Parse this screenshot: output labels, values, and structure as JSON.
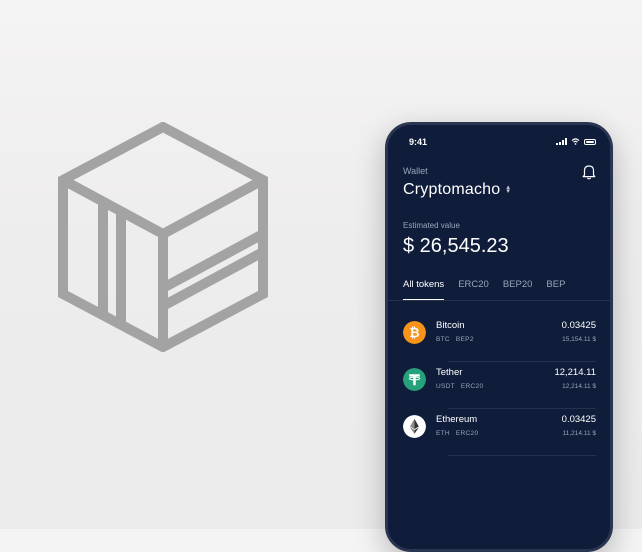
{
  "status": {
    "time": "9:41"
  },
  "wallet": {
    "label": "Wallet",
    "name": "Cryptomacho",
    "name_chevron": "⌃⌄",
    "estimated_label": "Estimated value",
    "estimated_value": "$ 26,545.23"
  },
  "tabs": [
    {
      "label": "All tokens",
      "active": true
    },
    {
      "label": "ERC20",
      "active": false
    },
    {
      "label": "BEP20",
      "active": false
    },
    {
      "label": "BEP",
      "active": false
    }
  ],
  "tokens": [
    {
      "name": "Bitcoin",
      "symbol": "BTC",
      "network": "BEP2",
      "amount": "0.03425",
      "fiat": "15,154.11 $",
      "color": "#f7931a",
      "icon": "bitcoin-icon",
      "glyph": "₿"
    },
    {
      "name": "Tether",
      "symbol": "USDT",
      "network": "ERC20",
      "amount": "12,214.11",
      "fiat": "12,214.11 $",
      "color": "#26a17b",
      "icon": "tether-icon",
      "glyph": "T"
    },
    {
      "name": "Ethereum",
      "symbol": "ETH",
      "network": "ERC20",
      "amount": "0.03425",
      "fiat": "11,214.11 $",
      "color": "#ffffff",
      "icon": "ethereum-icon",
      "glyph": ""
    }
  ],
  "colors": {
    "phone_background": "#0f1d3a",
    "logo_stroke": "#a3a3a3",
    "muted_text": "#9aa4bb"
  }
}
